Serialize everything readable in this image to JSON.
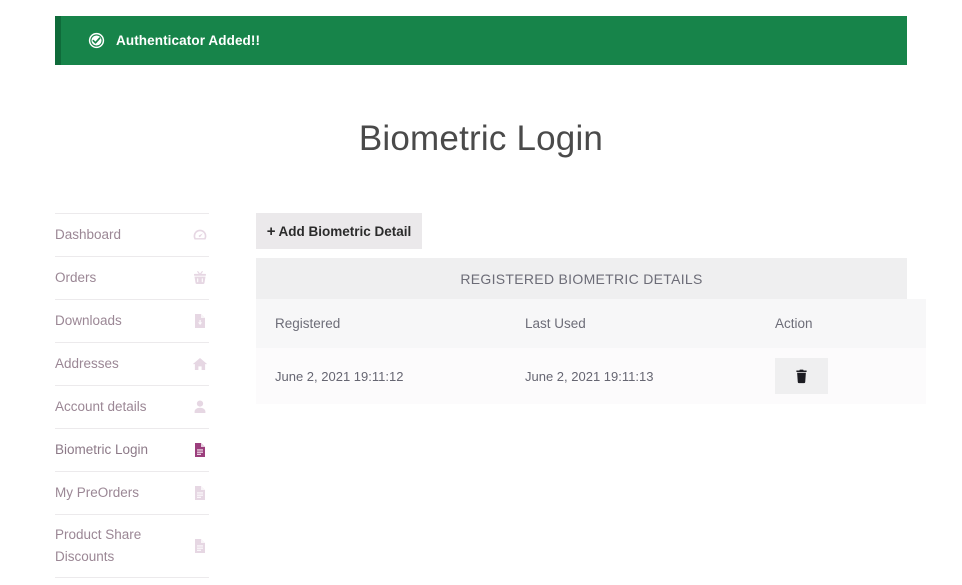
{
  "notice": {
    "icon": "check-circle-icon",
    "message": "Authenticator Added!!",
    "background_color": "#17844a",
    "text_color": "#ffffff"
  },
  "page": {
    "title": "Biometric Login"
  },
  "sidebar": {
    "items": [
      {
        "label": "Dashboard",
        "icon": "dashboard-icon",
        "active": false
      },
      {
        "label": "Orders",
        "icon": "basket-icon",
        "active": false
      },
      {
        "label": "Downloads",
        "icon": "file-download-icon",
        "active": false
      },
      {
        "label": "Addresses",
        "icon": "home-icon",
        "active": false
      },
      {
        "label": "Account details",
        "icon": "user-icon",
        "active": false
      },
      {
        "label": "Biometric Login",
        "icon": "file-icon",
        "active": true
      },
      {
        "label": "My PreOrders",
        "icon": "file-icon",
        "active": false
      },
      {
        "label": "Product Share Discounts",
        "icon": "file-icon",
        "active": false
      }
    ],
    "active_icon_color": "#9c3f7d",
    "icon_color": "#e6d7e3",
    "label_color": "#9b8795"
  },
  "toolbar": {
    "add_button_label": "Add Biometric Detail",
    "add_button_plus": "+"
  },
  "panel": {
    "heading": "REGISTERED BIOMETRIC DETAILS",
    "columns": [
      "Registered",
      "Last Used",
      "Action"
    ],
    "rows": [
      {
        "registered": "June 2, 2021 19:11:12",
        "last_used": "June 2, 2021 19:11:13",
        "action_icon": "trash-icon"
      }
    ]
  }
}
